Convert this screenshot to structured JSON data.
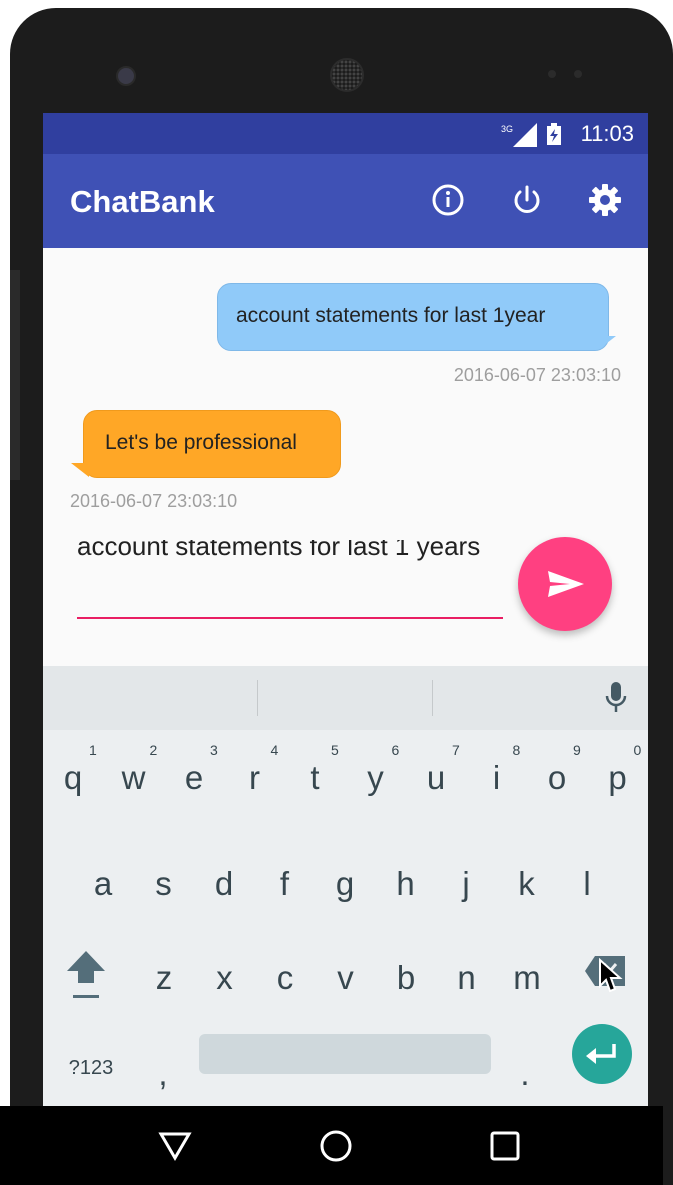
{
  "app": {
    "title": "ChatBank",
    "status_time": "11:03",
    "network_label": "3G",
    "accent": "#3f51b5",
    "status_color": "#303f9f"
  },
  "appbar_icons": [
    "info-icon",
    "power-icon",
    "settings-gear-icon"
  ],
  "messages": [
    {
      "side": "outgoing",
      "text": "account statements for last 1year",
      "time": "2016-06-07 23:03:10",
      "color": "#90caf9"
    },
    {
      "side": "incoming",
      "text": "Let's be professional",
      "time": "2016-06-07 23:03:10",
      "color": "#ffa726"
    }
  ],
  "compose": {
    "value": "account statements for last 1 years",
    "send_icon": "send-icon",
    "underline_color": "#e91e63",
    "send_color": "#ff4081"
  },
  "keyboard": {
    "row1": [
      "q",
      "w",
      "e",
      "r",
      "t",
      "y",
      "u",
      "i",
      "o",
      "p"
    ],
    "row1_numbers": [
      "1",
      "2",
      "3",
      "4",
      "5",
      "6",
      "7",
      "8",
      "9",
      "0"
    ],
    "row2": [
      "a",
      "s",
      "d",
      "f",
      "g",
      "h",
      "j",
      "k",
      "l"
    ],
    "row3": [
      "z",
      "x",
      "c",
      "v",
      "b",
      "n",
      "m"
    ],
    "symbols_key": "?123",
    "comma_key": ",",
    "period_key": ".",
    "enter_color": "#26a69a"
  },
  "navbar_icons": [
    "back-icon",
    "home-icon",
    "recents-icon"
  ]
}
